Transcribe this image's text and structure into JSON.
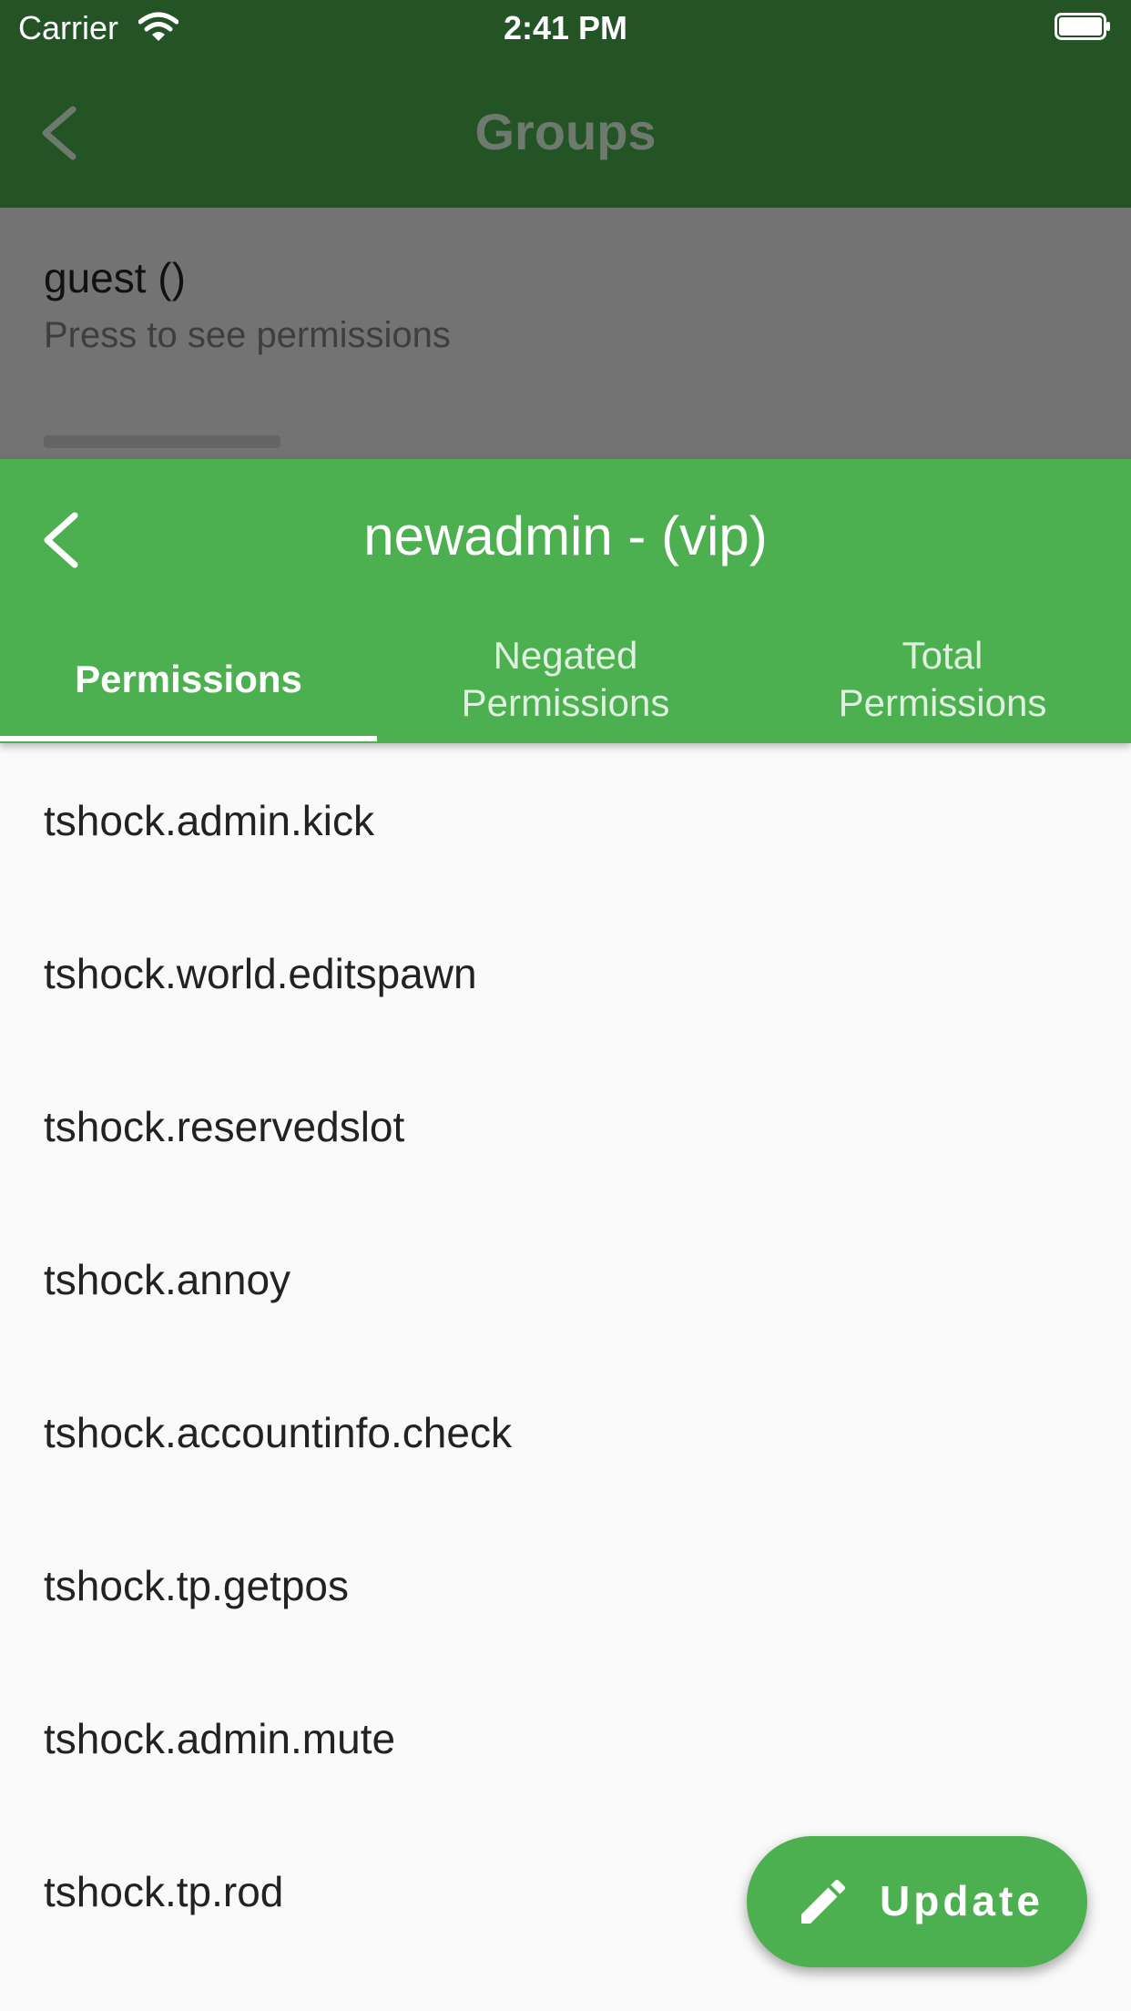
{
  "status_bar": {
    "carrier": "Carrier",
    "time": "2:41 PM"
  },
  "background_screen": {
    "title": "Groups",
    "list": [
      {
        "title": "guest ()",
        "subtitle": "Press to see permissions"
      }
    ]
  },
  "sheet": {
    "title": "newadmin - (vip)",
    "tabs": [
      {
        "line1": "Permissions",
        "line2": ""
      },
      {
        "line1": "Negated",
        "line2": "Permissions"
      },
      {
        "line1": "Total",
        "line2": "Permissions"
      }
    ],
    "permissions": [
      "tshock.admin.kick",
      "tshock.world.editspawn",
      "tshock.reservedslot",
      "tshock.annoy",
      "tshock.accountinfo.check",
      "tshock.tp.getpos",
      "tshock.admin.mute",
      "tshock.tp.rod"
    ]
  },
  "fab": {
    "label": "Update",
    "icon": "pencil-icon"
  },
  "colors": {
    "dark_green": "#245326",
    "accent_green": "#4caf50",
    "scrim_gray": "#737373",
    "background": "#fafafa"
  }
}
